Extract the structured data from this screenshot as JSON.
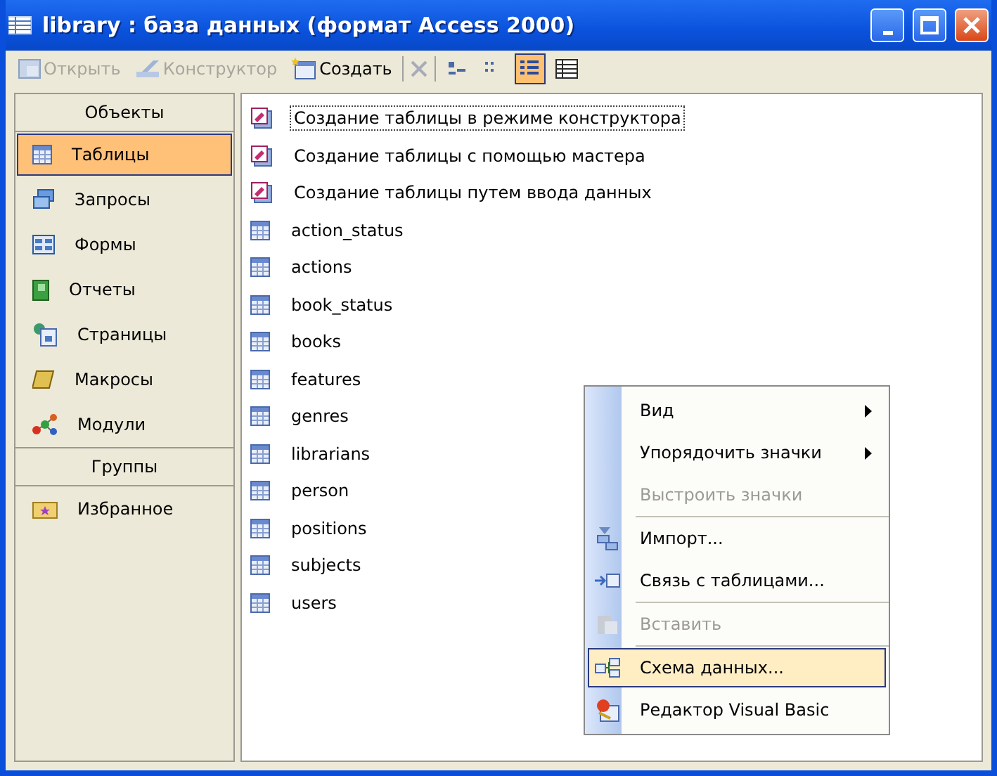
{
  "window": {
    "title": "library : база данных (формат Access 2000)"
  },
  "toolbar": {
    "buttons": [
      {
        "label": "Открыть",
        "kind": "open",
        "disabled": true
      },
      {
        "label": "Конструктор",
        "kind": "design",
        "disabled": true
      },
      {
        "label": "Создать",
        "kind": "new",
        "disabled": false
      }
    ],
    "views": [
      {
        "kind": "large",
        "selected": false
      },
      {
        "kind": "small",
        "selected": false
      },
      {
        "kind": "list",
        "selected": true
      },
      {
        "kind": "details",
        "selected": false
      }
    ]
  },
  "sidebar": {
    "sections": [
      {
        "title": "Объекты",
        "items": [
          {
            "label": "Таблицы",
            "kind": "table",
            "selected": true
          },
          {
            "label": "Запросы",
            "kind": "query",
            "selected": false
          },
          {
            "label": "Формы",
            "kind": "form",
            "selected": false
          },
          {
            "label": "Отчеты",
            "kind": "report",
            "selected": false
          },
          {
            "label": "Страницы",
            "kind": "page",
            "selected": false
          },
          {
            "label": "Макросы",
            "kind": "macro",
            "selected": false
          },
          {
            "label": "Модули",
            "kind": "module",
            "selected": false
          }
        ]
      },
      {
        "title": "Группы",
        "items": [
          {
            "label": "Избранное",
            "kind": "favorites",
            "selected": false
          }
        ]
      }
    ]
  },
  "objects": [
    {
      "label": "Создание таблицы в режиме конструктора",
      "kind": "shortcut",
      "focused": true
    },
    {
      "label": "Создание таблицы с помощью мастера",
      "kind": "shortcut",
      "focused": false
    },
    {
      "label": "Создание таблицы путем ввода данных",
      "kind": "shortcut",
      "focused": false
    },
    {
      "label": "action_status",
      "kind": "table",
      "focused": false
    },
    {
      "label": "actions",
      "kind": "table",
      "focused": false
    },
    {
      "label": "book_status",
      "kind": "table",
      "focused": false
    },
    {
      "label": "books",
      "kind": "table",
      "focused": false
    },
    {
      "label": "features",
      "kind": "table",
      "focused": false
    },
    {
      "label": "genres",
      "kind": "table",
      "focused": false
    },
    {
      "label": "librarians",
      "kind": "table",
      "focused": false
    },
    {
      "label": "person",
      "kind": "table",
      "focused": false
    },
    {
      "label": "positions",
      "kind": "table",
      "focused": false
    },
    {
      "label": "subjects",
      "kind": "table",
      "focused": false
    },
    {
      "label": "users",
      "kind": "table",
      "focused": false
    }
  ],
  "context_menu": [
    {
      "label": "Вид",
      "kind": "plain",
      "submenu": true,
      "disabled": false,
      "selected": false
    },
    {
      "label": "Упорядочить значки",
      "kind": "plain",
      "submenu": true,
      "disabled": false,
      "selected": false
    },
    {
      "label": "Выстроить значки",
      "kind": "plain",
      "submenu": false,
      "disabled": true,
      "selected": false
    },
    {
      "label": "Импорт...",
      "kind": "import",
      "submenu": false,
      "disabled": false,
      "selected": false
    },
    {
      "label": "Связь с таблицами...",
      "kind": "link",
      "submenu": false,
      "disabled": false,
      "selected": false
    },
    {
      "label": "Вставить",
      "kind": "paste",
      "submenu": false,
      "disabled": true,
      "selected": false
    },
    {
      "label": "Схема данных...",
      "kind": "schema",
      "submenu": false,
      "disabled": false,
      "selected": true
    },
    {
      "label": "Редактор Visual Basic",
      "kind": "vb",
      "submenu": false,
      "disabled": false,
      "selected": false
    }
  ]
}
